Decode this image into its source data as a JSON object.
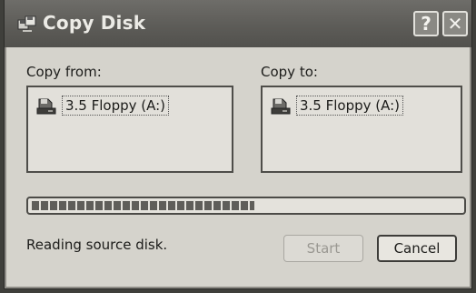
{
  "window": {
    "title": "Copy Disk",
    "help_label": "?",
    "close_label": "✕"
  },
  "copy_from": {
    "label": "Copy from:",
    "drive": "3.5 Floppy (A:)"
  },
  "copy_to": {
    "label": "Copy to:",
    "drive": "3.5 Floppy (A:)"
  },
  "progress": {
    "fraction": 0.52
  },
  "status_text": "Reading source disk.",
  "buttons": {
    "start_label": "Start",
    "start_enabled": false,
    "cancel_label": "Cancel"
  },
  "icons": {
    "title": "copy-disk-icon",
    "drive": "floppy-drive-icon"
  }
}
